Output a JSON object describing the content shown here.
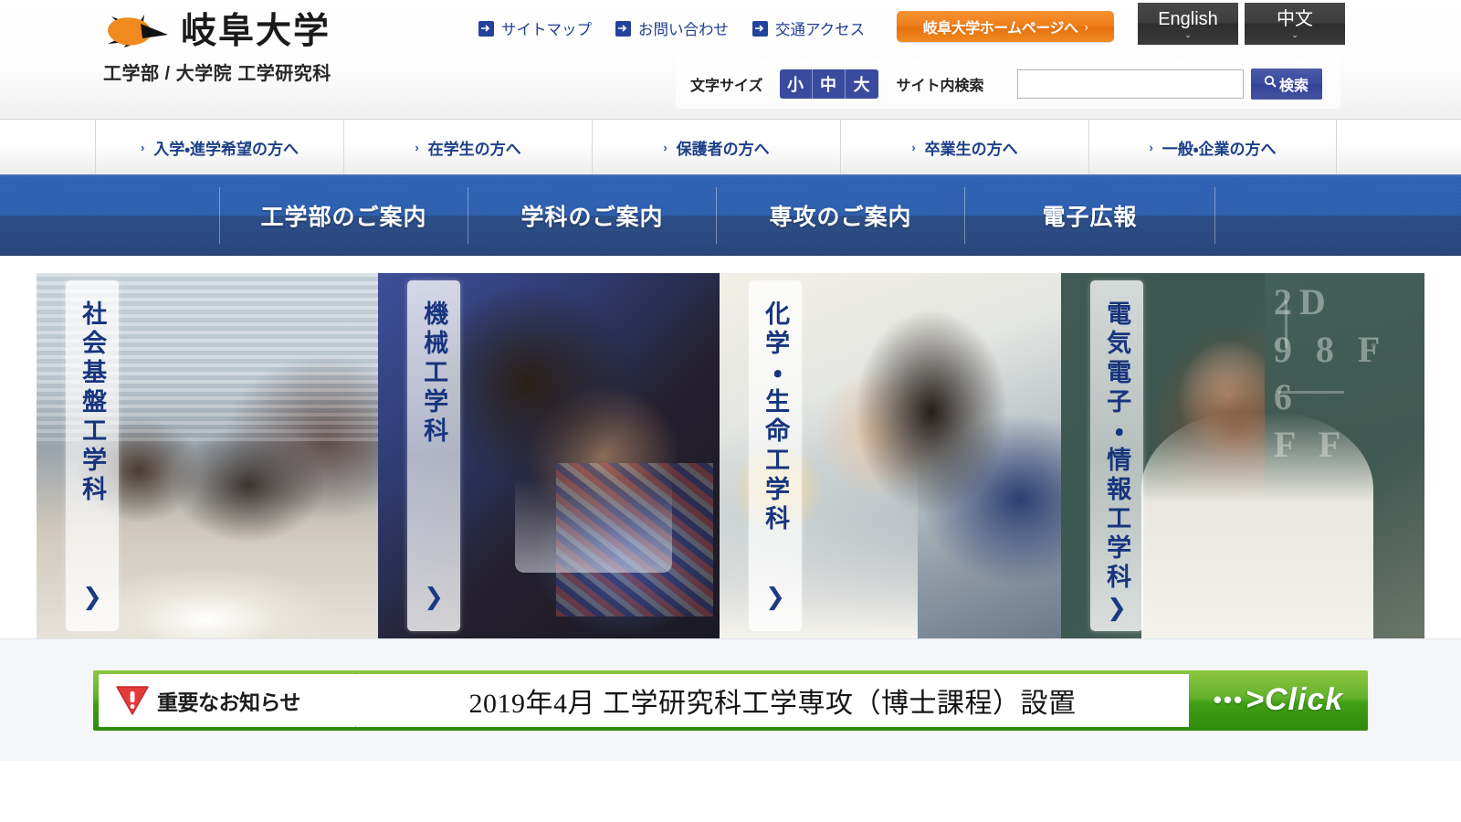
{
  "header": {
    "logo": {
      "icon": "gifu-university-swoosh-logo",
      "title": "岐阜大学",
      "subtitle": "工学部 / 大学院 工学研究科"
    },
    "util_links": [
      {
        "label": "サイトマップ",
        "icon": "arrow-right-icon"
      },
      {
        "label": "お問い合わせ",
        "icon": "arrow-right-icon"
      },
      {
        "label": "交通アクセス",
        "icon": "arrow-right-icon"
      }
    ],
    "gu_home_button": {
      "label": "岐阜大学ホームページへ",
      "chevron": "›",
      "color": "#ee7d18"
    },
    "lang_buttons": [
      {
        "label": "English",
        "caret": "⌄"
      },
      {
        "label": "中文",
        "caret": "⌄"
      }
    ],
    "font_size": {
      "label": "文字サイズ",
      "options": [
        {
          "label": "小"
        },
        {
          "label": "中"
        },
        {
          "label": "大"
        }
      ]
    },
    "search": {
      "label": "サイト内検索",
      "value": "",
      "placeholder": "",
      "button_label": "検索",
      "button_icon": "search-icon"
    }
  },
  "audience_nav": {
    "items": [
      {
        "label": "入学・進学希望の方へ",
        "chevron": "›"
      },
      {
        "label": "在学生の方へ",
        "chevron": "›"
      },
      {
        "label": "保護者の方へ",
        "chevron": "›"
      },
      {
        "label": "卒業生の方へ",
        "chevron": "›"
      },
      {
        "label": "一般・企業の方へ",
        "chevron": "›"
      }
    ]
  },
  "main_nav": {
    "accent_color": "#2d5eae",
    "items": [
      {
        "label": "工学部のご案内"
      },
      {
        "label": "学科のご案内"
      },
      {
        "label": "専攻のご案内"
      },
      {
        "label": "電子広報"
      }
    ]
  },
  "hero": {
    "panels": [
      {
        "label": "社会基盤工学科",
        "chevron": "❯",
        "photo": "students-around-site-model"
      },
      {
        "label": "機械工学科",
        "chevron": "❯",
        "photo": "male-student-in-laboratory"
      },
      {
        "label": "化学・生命工学科",
        "chevron": "❯",
        "photo": "female-student-profile-in-lab"
      },
      {
        "label": "電気電子・情報工学科",
        "chevron": "❯",
        "photo": "smiling-student-at-chalkboard"
      }
    ]
  },
  "banner": {
    "tag": {
      "icon": "warning-triangle-icon",
      "label": "重要なお知らせ",
      "icon_color": "#e23b3b"
    },
    "message": "2019年4月 工学研究科工学専攻（博士課程）設置",
    "cta": {
      "dots": "•••",
      "label": ">Click"
    },
    "background_color": "#3f9e14"
  }
}
